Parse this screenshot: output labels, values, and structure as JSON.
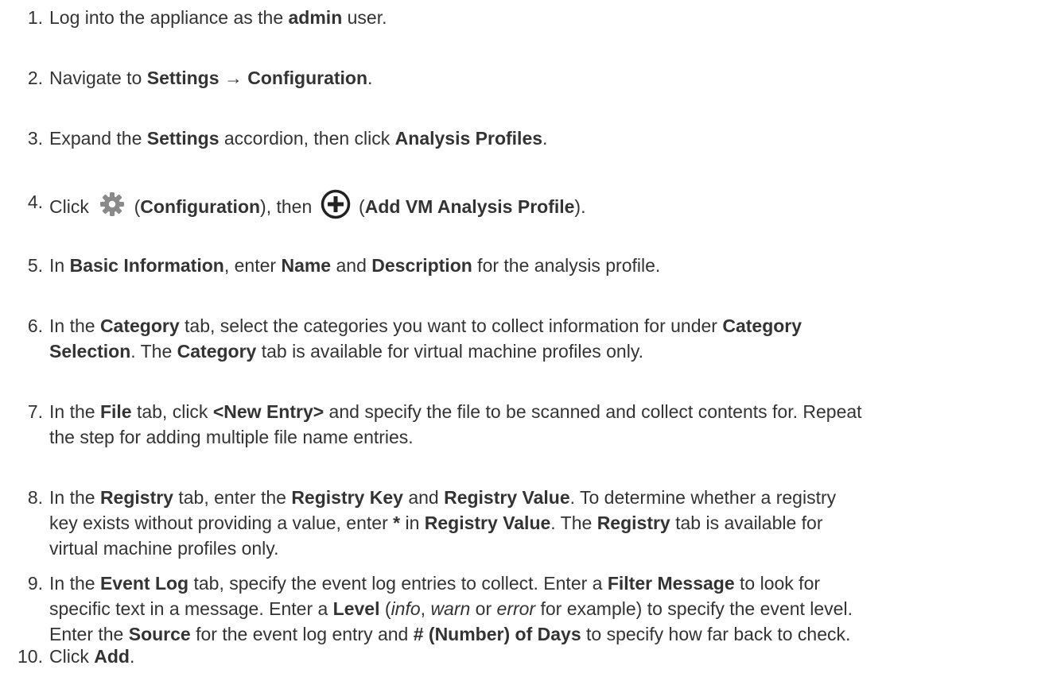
{
  "steps": [
    {
      "num": "1.",
      "t1": "Log into the appliance as the ",
      "b1": "admin",
      "t2": " user."
    },
    {
      "num": "2.",
      "t1": "Navigate to ",
      "b1": "Settings",
      "t2": " → ",
      "b2": "Configuration",
      "t3": "."
    },
    {
      "num": "3.",
      "t1": "Expand the ",
      "b1": "Settings",
      "t2": " accordion, then click ",
      "b2": "Analysis Profiles",
      "t3": "."
    },
    {
      "num": "4.",
      "t1": "Click ",
      "t2": " (",
      "b1": "Configuration",
      "t3": "), then ",
      "t4": " (",
      "b2": "Add VM Analysis Profile",
      "t5": ")."
    },
    {
      "num": "5.",
      "t1": "In ",
      "b1": "Basic Information",
      "t2": ", enter ",
      "b2": "Name",
      "t3": " and ",
      "b3": "Description",
      "t4": " for the analysis profile."
    },
    {
      "num": "6.",
      "t1": "In the ",
      "b1": "Category",
      "t2": " tab, select the categories you want to collect information for under ",
      "b2": "Category",
      "t3": " ",
      "b3": "Selection",
      "t4": ". The ",
      "b4": "Category",
      "t5": " tab is available for virtual machine profiles only."
    },
    {
      "num": "7.",
      "t1": "In the ",
      "b1": "File",
      "t2": " tab, click ",
      "b2": "<New Entry>",
      "t3": " and specify the file to be scanned and collect contents for. Repeat",
      "t4": "the step for adding multiple file name entries."
    },
    {
      "num": "8.",
      "t1": "In the ",
      "b1": "Registry",
      "t2": " tab, enter the ",
      "b2": "Registry Key",
      "t3": " and ",
      "b3": "Registry Value",
      "t4": ". To determine whether a registry",
      "t5": "key exists without providing a value, enter ",
      "b4": "*",
      "t6": " in ",
      "b5": "Registry Value",
      "t7": ". The ",
      "b6": "Registry",
      "t8": " tab is available for",
      "t9": "virtual machine profiles only."
    },
    {
      "num": "9.",
      "t1": "In the ",
      "b1": "Event Log",
      "t2": " tab, specify the event log entries to collect. Enter a ",
      "b2": "Filter Message",
      "t3": " to look for",
      "t4": "specific text in a message. Enter a ",
      "b3": "Level",
      "t5": " (",
      "i1": "info",
      "t6": ", ",
      "i2": "warn",
      "t7": " or ",
      "i3": "error",
      "t8": " for example) to specify the event level.",
      "t9": "Enter the ",
      "b4": "Source",
      "t10": " for the event log entry and ",
      "b5": "# (Number) of Days",
      "t11": " to specify how far back to check."
    },
    {
      "num": "10.",
      "t1": "Click ",
      "b1": "Add",
      "t2": "."
    }
  ],
  "icons": {
    "gear": "gear-icon",
    "plus": "add-circle-icon"
  },
  "colors": {
    "text": "#333333",
    "icon_gray": "#8a8a8a",
    "icon_dark": "#222222"
  }
}
